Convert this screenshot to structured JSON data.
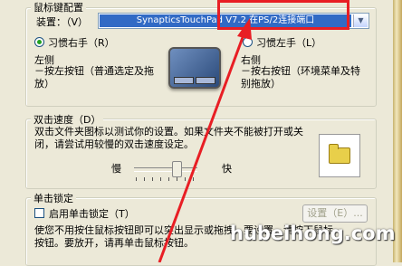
{
  "group_button_config": {
    "title": "鼠标键配置",
    "device_label": "装置：（V）",
    "device_value": "SynapticsTouchPad V7.2 在PS/2连接端口",
    "right_handed_label": "习惯右手（R）",
    "left_handed_label": "习惯左手（L）",
    "left_heading": "左侧",
    "left_desc": "－按左按钮（普通选定及拖放）",
    "right_heading": "右侧",
    "right_desc": "－按右按钮（环境菜单及特别拖放）",
    "handedness_selected": "right"
  },
  "group_double_click": {
    "title": "双击速度（D）",
    "description": "双击文件夹图标以测试你的设置。如果文件夹不能被打开或关闭，请尝试用较慢的双击速度设定。",
    "slow_label": "慢",
    "fast_label": "快",
    "speed_value": 0.6
  },
  "group_click_lock": {
    "title": "单击锁定",
    "enable_label": "启用单击锁定（T）",
    "settings_button": "设置（E）...",
    "description": "使您不用按住鼠标按钮即可以突出显示或拖拽。要设置，请按下鼠标按钮。要放开，请再单击鼠标按钮。",
    "enabled": false
  },
  "watermark": "hubeihong.com",
  "colors": {
    "highlight": "#316ac5",
    "annotation": "#e81e24",
    "window_bg": "#ece9d8"
  }
}
